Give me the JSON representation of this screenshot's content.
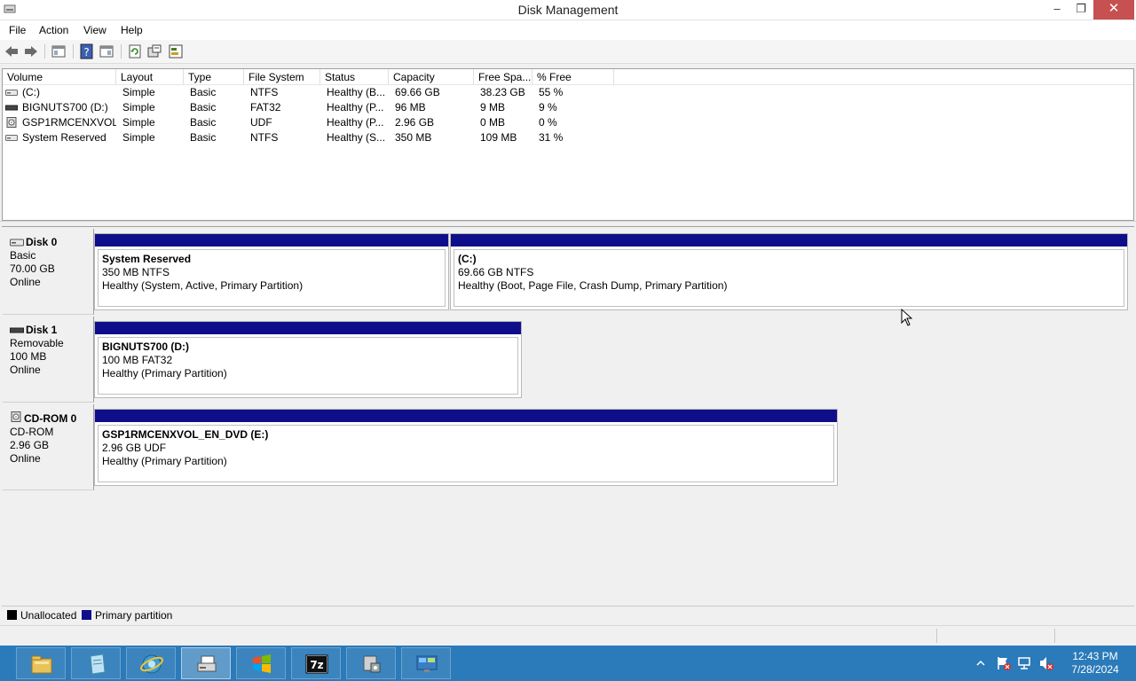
{
  "window": {
    "title": "Disk Management",
    "minimize": "–",
    "restore": "❐",
    "close": "✕"
  },
  "menu": {
    "file": "File",
    "action": "Action",
    "view": "View",
    "help": "Help"
  },
  "toolbar": {
    "icons": [
      "back-icon",
      "forward-icon",
      "show-hide-console-tree-icon",
      "help-icon",
      "properties-icon",
      "refresh-icon",
      "rescan-disks-icon",
      "export-list-icon"
    ]
  },
  "volume_list": {
    "columns": [
      "Volume",
      "Layout",
      "Type",
      "File System",
      "Status",
      "Capacity",
      "Free Spa...",
      "% Free"
    ],
    "rows": [
      {
        "volume": "(C:)",
        "layout": "Simple",
        "type": "Basic",
        "fs": "NTFS",
        "status": "Healthy (B...",
        "capacity": "69.66 GB",
        "free": "38.23 GB",
        "pct": "55 %",
        "icon": "volume-icon"
      },
      {
        "volume": "BIGNUTS700 (D:)",
        "layout": "Simple",
        "type": "Basic",
        "fs": "FAT32",
        "status": "Healthy (P...",
        "capacity": "96 MB",
        "free": "9 MB",
        "pct": "9 %",
        "icon": "removable-volume-icon"
      },
      {
        "volume": "GSP1RMCENXVOL...",
        "layout": "Simple",
        "type": "Basic",
        "fs": "UDF",
        "status": "Healthy (P...",
        "capacity": "2.96 GB",
        "free": "0 MB",
        "pct": "0 %",
        "icon": "cd-volume-icon"
      },
      {
        "volume": "System Reserved",
        "layout": "Simple",
        "type": "Basic",
        "fs": "NTFS",
        "status": "Healthy (S...",
        "capacity": "350 MB",
        "free": "109 MB",
        "pct": "31 %",
        "icon": "volume-icon"
      }
    ]
  },
  "disks": [
    {
      "name": "Disk 0",
      "type": "Basic",
      "size": "70.00 GB",
      "state": "Online",
      "partitions": [
        {
          "name": "System Reserved",
          "size": "350 MB NTFS",
          "status": "Healthy (System, Active, Primary Partition)"
        },
        {
          "name": " (C:)",
          "size": "69.66 GB NTFS",
          "status": "Healthy (Boot, Page File, Crash Dump, Primary Partition)"
        }
      ]
    },
    {
      "name": "Disk 1",
      "type": "Removable",
      "size": "100 MB",
      "state": "Online",
      "partitions": [
        {
          "name": "BIGNUTS700  (D:)",
          "size": "100 MB FAT32",
          "status": "Healthy (Primary Partition)"
        }
      ]
    },
    {
      "name": "CD-ROM 0",
      "type": "CD-ROM",
      "size": "2.96 GB",
      "state": "Online",
      "partitions": [
        {
          "name": "GSP1RMCENXVOL_EN_DVD  (E:)",
          "size": "2.96 GB UDF",
          "status": "Healthy (Primary Partition)"
        }
      ]
    }
  ],
  "legend": {
    "unallocated": "Unallocated",
    "primary": "Primary partition",
    "unallocated_color": "#000000",
    "primary_color": "#0e0e8b"
  },
  "taskbar": {
    "apps": [
      "file-explorer-icon",
      "notepad-icon",
      "internet-explorer-icon",
      "disk-management-icon",
      "windows-start-icon",
      "7zip-icon",
      "computer-management-icon",
      "control-panel-icon"
    ],
    "seven_zip_label": "7z",
    "clock_time": "12:43 PM",
    "clock_date": "7/28/2024",
    "accent": "#2b7ab9"
  }
}
